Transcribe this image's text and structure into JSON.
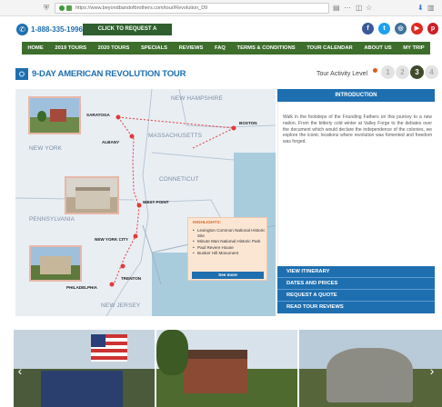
{
  "browser": {
    "url": "https://www.beyondbandofbrothers.com/tour/Revolution_D9"
  },
  "header": {
    "phone": "1-888-335-1996",
    "brochure_label": "CLICK TO REQUEST A BROCHURE"
  },
  "nav": {
    "items": [
      "HOME",
      "2019 TOURS",
      "2020 TOURS",
      "SPECIALS",
      "REVIEWS",
      "FAQ",
      "TERMS & CONDITIONS",
      "TOUR CALENDAR",
      "ABOUT US",
      "MY TRIP"
    ]
  },
  "tour": {
    "title": "9-DAY AMERICAN REVOLUTION TOUR",
    "activity_label": "Tour Activity Level",
    "levels": [
      "1",
      "2",
      "3",
      "4"
    ],
    "active_level": 3
  },
  "map": {
    "states": [
      "NEW HAMPSHIRE",
      "MASSACHUSETTS",
      "NEW YORK",
      "CONNETICUT",
      "PENNSYLVANIA",
      "NEW JERSEY"
    ],
    "cities": [
      "BOSTON",
      "SARATOGA",
      "ALBANY",
      "WEST POINT",
      "NEW YORK CITY",
      "TRENTON",
      "PHILADELPHIA"
    ],
    "highlights_title": "HIGHLIGHTS:",
    "highlights": [
      "Lexington Common National Historic Site",
      "Minute Man National Historic Park",
      "Paul Revere House",
      "Bunker Hill Monument"
    ],
    "see_more": "See more"
  },
  "intro": {
    "heading": "INTRODUCTION",
    "text": "Walk in the footsteps of the Founding Fathers on this journey to a new nation. From the bitterly cold winter at Valley Forge to the debates over the document which would declare the independence of the colonies, we explore the iconic locations where revolution was fomented and freedom was forged."
  },
  "side_buttons": [
    "VIEW ITINERARY",
    "DATES AND PRICES",
    "REQUEST A QUOTE",
    "READ TOUR REVIEWS"
  ],
  "colors": {
    "primary_blue": "#1e6fb0",
    "nav_green": "#3d6e2c",
    "route_red": "#e03a3a"
  }
}
